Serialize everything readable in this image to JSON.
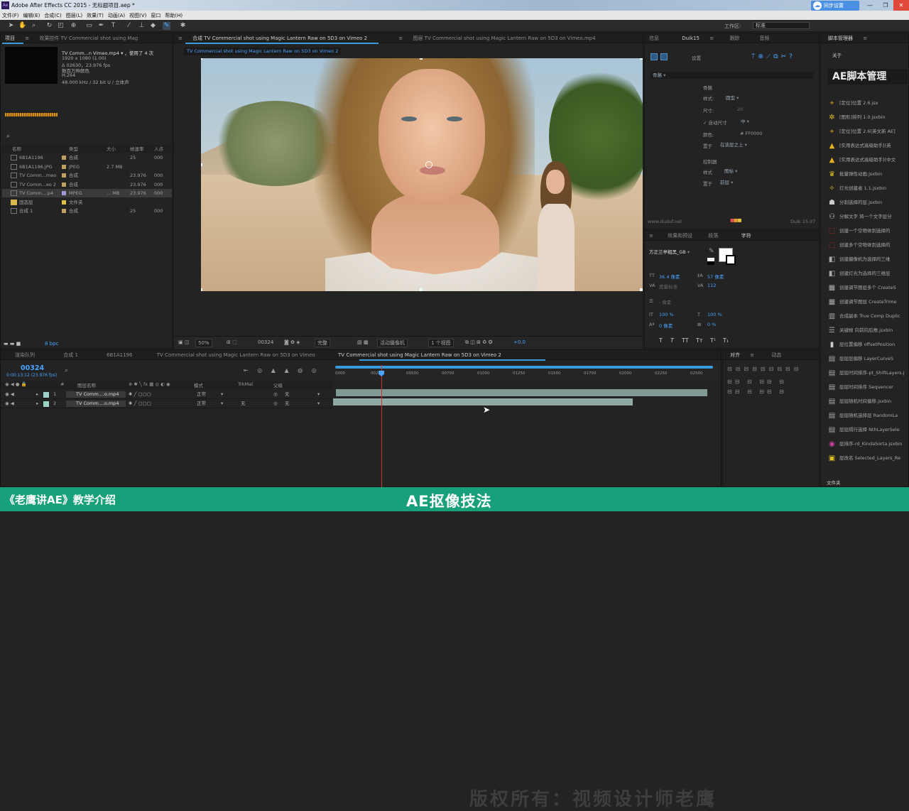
{
  "window": {
    "title": "Adobe After Effects CC 2015 - 无标题项目.aep *",
    "controls": [
      "—",
      "❐",
      "✕"
    ]
  },
  "menu": [
    "文件(F)",
    "编辑(E)",
    "合成(C)",
    "图层(L)",
    "效果(T)",
    "动画(A)",
    "视图(V)",
    "窗口",
    "帮助(H)"
  ],
  "toolbar": {
    "workspace_label": "工作区:",
    "workspace_value": "标准",
    "sync_label": "同步设置"
  },
  "project": {
    "tabs": [
      "项目",
      "≡",
      "效果控件 TV Commercial shot using Mag"
    ],
    "info": [
      "TV Comm...n Vimeo.mp4 ▾ ，使用了 4 次",
      "1920 x 1080 (1.00)",
      "Δ 02630，23.976 fps",
      "数百万种颜色",
      "H.264",
      "48.000 kHz / 32 bit U / 立体声"
    ],
    "search_icon": "⌕",
    "columns": {
      "name": "名称",
      "type": "类型",
      "size": "大小",
      "fps": "帧速率",
      "in": "入点"
    },
    "rows": [
      {
        "name": "6B1A1196",
        "type": "合成",
        "size": "",
        "fps": "25",
        "in": "000",
        "color": "#c0a060"
      },
      {
        "name": "6B1A1196.JPG",
        "type": "JPEG",
        "size": "2.7 MB",
        "fps": "",
        "in": "",
        "color": "#c0a060"
      },
      {
        "name": "TV Comm...meo",
        "type": "合成",
        "size": "",
        "fps": "23.976",
        "in": "000",
        "color": "#c0a060"
      },
      {
        "name": "TV Comm...eo 2",
        "type": "合成",
        "size": "",
        "fps": "23.976",
        "in": "000",
        "color": "#c0a060"
      },
      {
        "name": "TV Comm....p4",
        "type": "MPEG",
        "size": "... MB",
        "fps": "23.976",
        "in": "000",
        "color": "#9a9ad0"
      },
      {
        "name": "固态层",
        "type": "文件夹",
        "size": "",
        "fps": "",
        "in": "",
        "color": "#e0c040"
      },
      {
        "name": "合成 1",
        "type": "合成",
        "size": "",
        "fps": "25",
        "in": "000",
        "color": "#c0a060"
      }
    ],
    "footer": "8 bpc"
  },
  "comp": {
    "tabs": [
      "≡",
      "合成 TV Commercial shot using Magic Lantern Raw on 5D3 on Vimeo 2",
      "≡",
      "图层 TV Commercial shot using Magic Lantern Raw on 5D3 on Vimeo.mp4"
    ],
    "subtab": "TV Commercial shot using Magic Lantern Raw on 5D3 on Vimeo 2",
    "footer": {
      "zoom": "50%",
      "time": "00324",
      "res": "完整",
      "camera": "活动摄像机",
      "views": "1 个视图",
      "exposure": "+0.0"
    }
  },
  "duik": {
    "tabs": [
      "信息",
      "Duik15",
      "≡",
      "跟踪",
      "音频"
    ],
    "settings": "设置",
    "dropdown": "骨骼",
    "sec1": "骨骼",
    "style_label": "样式:",
    "style_value": "圆型",
    "size_label": "尺寸:",
    "size_value": "20",
    "auto_size": "✓ 自动尺寸",
    "auto_value": "中",
    "color_label": "颜色:",
    "color_value": "# FF0000",
    "place_label": "置于",
    "place_value": "在该层之上",
    "sec2": "控制器",
    "ctrl_style_label": "样式",
    "ctrl_style_value": "图标",
    "ctrl_place_label": "置于",
    "ctrl_place_value": "前层",
    "url": "www.duduf.net",
    "version": "Duik 15.07"
  },
  "character": {
    "tabs": [
      "≡",
      "效果和预设",
      "段落",
      "字符"
    ],
    "font": "方正兰亭粗黑_GB",
    "size": "36.4 像素",
    "leading": "57 像素",
    "kern": "度量标准",
    "track": "112",
    "stroke": "- 像素",
    "vscale": "100 %",
    "hscale": "100 %",
    "baseline": "0 像素",
    "tsume": "0 %",
    "styles": [
      "T",
      "T",
      "TT",
      "Tт",
      "T¹",
      "T₁"
    ]
  },
  "timeline": {
    "tabs": [
      "渲染队列",
      "合成 1",
      "6B1A1196",
      "TV Commercial shot using Magic Lantern Raw on 5D3 on Vimeo",
      "TV Commercial shot using Magic Lantern Raw on 5D3 on Vimeo 2"
    ],
    "timecode": "00324",
    "timecode_sub": "0:00:13:12 (23.976 fps)",
    "columns": {
      "name": "图层名称",
      "mode": "模式",
      "trkmat": "TrkMat",
      "parent": "父级"
    },
    "layers": [
      {
        "num": "1",
        "name": "TV Comm....o.mp4",
        "mode": "正常",
        "trkmat": "",
        "parent": "无"
      },
      {
        "num": "2",
        "name": "TV Comm....o.mp4",
        "mode": "正常",
        "trkmat": "无",
        "parent": "无"
      }
    ],
    "ruler": [
      "0000",
      "00250",
      "00500",
      "00750",
      "01000",
      "01250",
      "01500",
      "01750",
      "02000",
      "02250",
      "02500"
    ],
    "watermark": "版权所有：视频设计师老鹰"
  },
  "align": {
    "tabs": [
      "对齐",
      "≡",
      "动态"
    ]
  },
  "scripts": {
    "tabs": [
      "脚本管理器",
      "≡"
    ],
    "about": "关于",
    "header": "AE脚本管理",
    "items": [
      {
        "icon": "⌖",
        "name": "[定位]位置 2.6.jsx",
        "color": "#e0a020"
      },
      {
        "icon": "✲",
        "name": "[图形]排列 1.0.jsxbin",
        "color": "#e0c020"
      },
      {
        "icon": "⌖",
        "name": "[定位]位置 2.6[英文新 AE]",
        "color": "#e0a020"
      },
      {
        "icon": "▲",
        "name": "[实用表达式高级助手](英",
        "color": "#e0b020"
      },
      {
        "icon": "▲",
        "name": "[实用表达式高级助手](中文",
        "color": "#e0b020"
      },
      {
        "icon": "♛",
        "name": "批量弹性动画.jsxbin",
        "color": "#e0c020"
      },
      {
        "icon": "✧",
        "name": "灯光创建者 1.1.jsxbin",
        "color": "#e0c020"
      },
      {
        "icon": "☗",
        "name": "分割选择的层.jsxbin",
        "color": "#cccccc"
      },
      {
        "icon": "⚇",
        "name": "分解文字 将一个文字层分",
        "color": "#cccccc"
      },
      {
        "icon": "⬚",
        "name": "创建一个空物体到选择的",
        "color": "#d03030"
      },
      {
        "icon": "⬚",
        "name": "创建多个空物体到选择的",
        "color": "#d03030"
      },
      {
        "icon": "◧",
        "name": "创建摄像机为选择的三维",
        "color": "#aaaaaa"
      },
      {
        "icon": "◧",
        "name": "创建灯光为选择的三维层",
        "color": "#aaaaaa"
      },
      {
        "icon": "▦",
        "name": "创建调节图层多个 CreateS",
        "color": "#aaaaaa"
      },
      {
        "icon": "▦",
        "name": "创建调节图层 CreateTrime",
        "color": "#aaaaaa"
      },
      {
        "icon": "▥",
        "name": "合成副本 True Comp Duplic",
        "color": "#aaaaaa"
      },
      {
        "icon": "☰",
        "name": "关键帧 向前向后推.jsxbin",
        "color": "#aaaaaa"
      },
      {
        "icon": "▮",
        "name": "层位置偏移 offsetPosition",
        "color": "#cccccc"
      },
      {
        "icon": "▤",
        "name": "层层层偏移 LayerCurveS",
        "color": "#aaaaaa"
      },
      {
        "icon": "▤",
        "name": "层层时间排序-pt_ShiftLayers.j",
        "color": "#aaaaaa"
      },
      {
        "icon": "▤",
        "name": "层层时间排序 Sequencer",
        "color": "#aaaaaa"
      },
      {
        "icon": "▤",
        "name": "层层随机时间偏移.jsxbin",
        "color": "#aaaaaa"
      },
      {
        "icon": "▤",
        "name": "层层随机选择层 RandomLa",
        "color": "#aaaaaa"
      },
      {
        "icon": "▤",
        "name": "层层隔行选择 NthLayerSele",
        "color": "#aaaaaa"
      },
      {
        "icon": "◉",
        "name": "层排序-rd_KindaSorta.jsxbin",
        "color": "#d040a0"
      },
      {
        "icon": "▣",
        "name": "层改名 Selected_Layers_Re",
        "color": "#e0c020"
      }
    ],
    "footer": "文件夹"
  },
  "banner": {
    "left": "《老鹰讲AE》教学介绍",
    "center": "AE抠像技法"
  }
}
